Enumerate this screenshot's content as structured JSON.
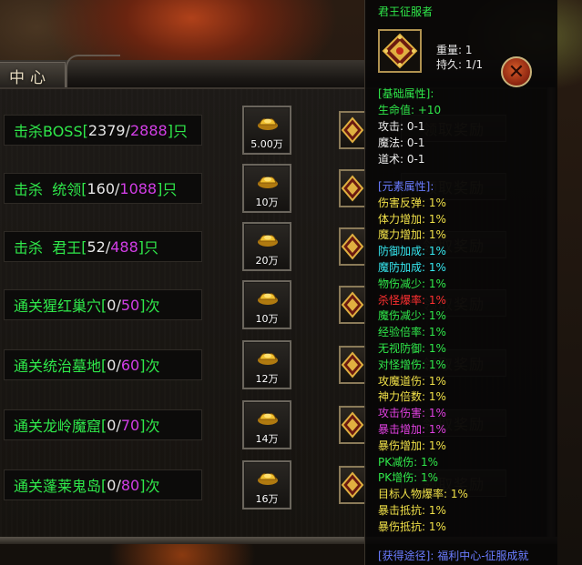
{
  "panel": {
    "tab_label": "中心"
  },
  "rows": [
    {
      "prefix": "击杀BOSS",
      "gap": "",
      "target": "",
      "open": "[",
      "done": "2379",
      "sep": "/",
      "total": "2888",
      "close": "]",
      "unit": "只",
      "color": "g",
      "reward": "5.00万"
    },
    {
      "prefix": "击杀",
      "gap": "  ",
      "target": "统领",
      "open": "[",
      "done": "160",
      "sep": "/",
      "total": "1088",
      "close": "]",
      "unit": "只",
      "color": "g",
      "reward": "10万"
    },
    {
      "prefix": "击杀",
      "gap": "  ",
      "target": "君王",
      "open": "[",
      "done": "52",
      "sep": "/",
      "total": "488",
      "close": "]",
      "unit": "只",
      "color": "g",
      "reward": "20万"
    },
    {
      "prefix": "通关猩红巢穴",
      "gap": "",
      "target": "",
      "open": "[",
      "done": "0",
      "sep": "/",
      "total": "50",
      "close": "]",
      "unit": "次",
      "color": "g",
      "reward": "10万"
    },
    {
      "prefix": "通关统治墓地",
      "gap": "",
      "target": "",
      "open": "[",
      "done": "0",
      "sep": "/",
      "total": "60",
      "close": "]",
      "unit": "次",
      "color": "g",
      "reward": "12万"
    },
    {
      "prefix": "通关龙岭魔窟",
      "gap": "",
      "target": "",
      "open": "[",
      "done": "0",
      "sep": "/",
      "total": "70",
      "close": "]",
      "unit": "次",
      "color": "g",
      "reward": "14万"
    },
    {
      "prefix": "通关蓬莱鬼岛",
      "gap": "",
      "target": "",
      "open": "[",
      "done": "0",
      "sep": "/",
      "total": "80",
      "close": "]",
      "unit": "次",
      "color": "g",
      "reward": "16万"
    }
  ],
  "claim_label": "领取奖励",
  "tooltip": {
    "title": "君王征服者",
    "weight": "重量: 1",
    "durability": "持久: 1/1",
    "lines": [
      {
        "text": "[基础属性]:",
        "color": "green"
      },
      {
        "text": "生命值: +10",
        "color": "green"
      },
      {
        "text": "攻击: 0-1",
        "color": "white"
      },
      {
        "text": "魔法: 0-1",
        "color": "white"
      },
      {
        "text": "道术: 0-1",
        "color": "white"
      },
      {
        "text": "[元素属性]:",
        "color": "blue"
      },
      {
        "text": "伤害反弹: 1%",
        "color": "yellow"
      },
      {
        "text": "体力增加: 1%",
        "color": "yellow"
      },
      {
        "text": "魔力增加: 1%",
        "color": "yellow"
      },
      {
        "text": "防御加成: 1%",
        "color": "cyan"
      },
      {
        "text": "魔防加成: 1%",
        "color": "cyan"
      },
      {
        "text": "物伤减少: 1%",
        "color": "green"
      },
      {
        "text": "杀怪爆率: 1%",
        "color": "red"
      },
      {
        "text": "魔伤减少: 1%",
        "color": "green"
      },
      {
        "text": "经验倍率: 1%",
        "color": "green"
      },
      {
        "text": "无视防御: 1%",
        "color": "green"
      },
      {
        "text": "对怪增伤: 1%",
        "color": "green"
      },
      {
        "text": "攻魔道伤: 1%",
        "color": "yellow"
      },
      {
        "text": "神力倍数: 1%",
        "color": "yellow"
      },
      {
        "text": "攻击伤害: 1%",
        "color": "magenta"
      },
      {
        "text": "暴击增加: 1%",
        "color": "magenta"
      },
      {
        "text": "暴伤增加: 1%",
        "color": "yellow"
      },
      {
        "text": "PK减伤: 1%",
        "color": "green"
      },
      {
        "text": "PK增伤: 1%",
        "color": "green"
      },
      {
        "text": "目标人物爆率: 1%",
        "color": "yellow"
      },
      {
        "text": "暴击抵抗: 1%",
        "color": "yellow"
      },
      {
        "text": "暴伤抵抗: 1%",
        "color": "yellow"
      }
    ],
    "source": "[获得途径]: 福利中心-征服成就"
  },
  "colors": {
    "accent_green": "#2fe84a",
    "accent_magenta": "#d23ee6",
    "gold": "#b09250"
  }
}
